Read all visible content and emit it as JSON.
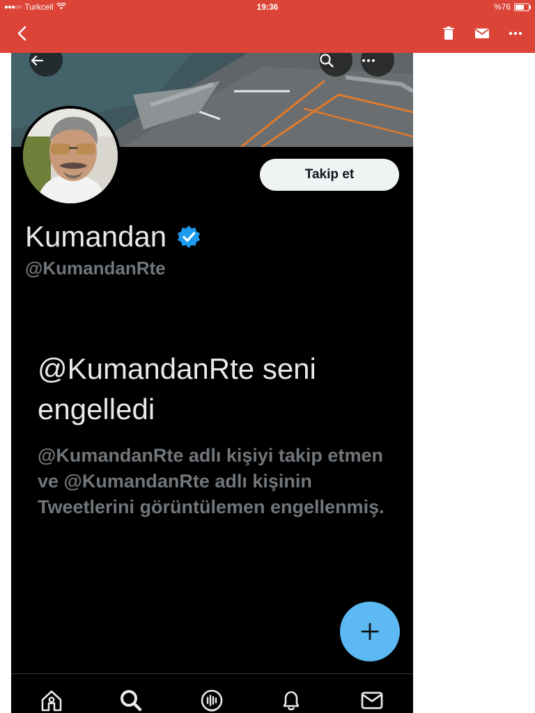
{
  "status_bar": {
    "carrier": "Turkcell",
    "time": "19:36",
    "battery": "%76",
    "battery_level": 0.76
  },
  "app_bar": {
    "back_icon": "chevron-left-icon",
    "actions": [
      "trash-icon",
      "mail-icon",
      "more-icon"
    ]
  },
  "profile": {
    "follow_label": "Takip et",
    "display_name": "Kumandan",
    "handle": "@KumandanRte",
    "verified": true
  },
  "blocked": {
    "title": "@KumandanRte seni engelledi",
    "body": "@KumandanRte adlı kişiyi takip etmen ve @KumandanRte adlı kişinin Tweetlerini görüntülemen engellenmiş."
  },
  "colors": {
    "app_bar": "#db4437",
    "accent": "#1d9bf0",
    "fab": "#5cb9f2",
    "background": "#000000"
  },
  "bottom_nav": [
    "home-icon",
    "search-icon",
    "spaces-icon",
    "notifications-icon",
    "messages-icon"
  ]
}
